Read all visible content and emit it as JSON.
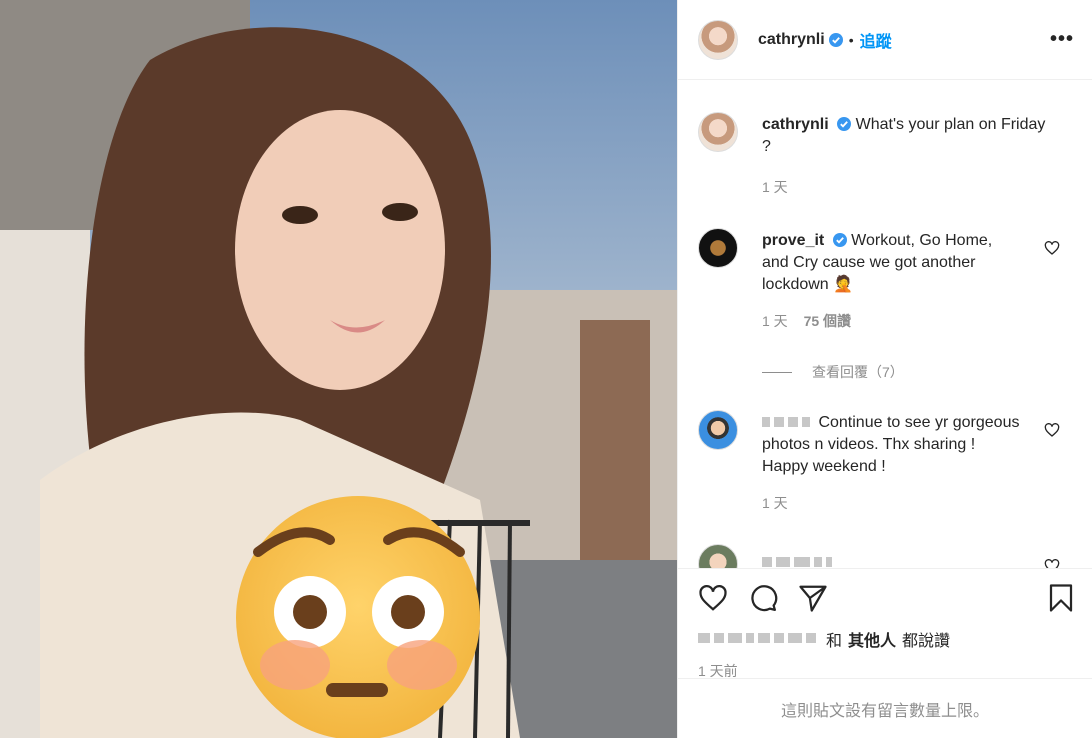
{
  "post": {
    "username": "cathrynli",
    "follow_label": "追蹤",
    "more_label": "•••"
  },
  "caption": {
    "username": "cathrynli",
    "text": "What's your plan on Friday ?",
    "time": "1 天"
  },
  "comments": [
    {
      "username": "prove_it",
      "text": "Workout, Go Home, and Cry cause we got another lockdown 🤦",
      "time": "1 天",
      "likes": "75 個讚",
      "replies_label": "查看回覆（7）"
    },
    {
      "username": "",
      "text": "Continue to see yr gorgeous photos n videos. Thx sharing ! Happy weekend !",
      "time": "1 天"
    }
  ],
  "likes_line": {
    "connector": "和",
    "others": "其他人",
    "suffix": "都說讚"
  },
  "timestamp": "1 天前",
  "footer": "這則貼文設有留言數量上限。"
}
